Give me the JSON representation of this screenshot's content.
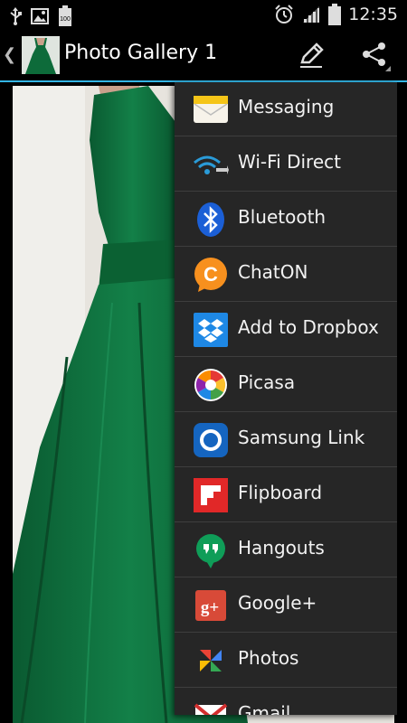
{
  "status_bar": {
    "time": "12:35",
    "battery_level": "100"
  },
  "action_bar": {
    "title": "Photo Gallery 1"
  },
  "share_menu": {
    "items": [
      {
        "label": "Messaging",
        "icon": "messaging-icon"
      },
      {
        "label": "Wi-Fi Direct",
        "icon": "wifi-direct-icon"
      },
      {
        "label": "Bluetooth",
        "icon": "bluetooth-icon"
      },
      {
        "label": "ChatON",
        "icon": "chaton-icon"
      },
      {
        "label": "Add to Dropbox",
        "icon": "dropbox-icon"
      },
      {
        "label": "Picasa",
        "icon": "picasa-icon"
      },
      {
        "label": "Samsung Link",
        "icon": "samsung-link-icon"
      },
      {
        "label": "Flipboard",
        "icon": "flipboard-icon"
      },
      {
        "label": "Hangouts",
        "icon": "hangouts-icon"
      },
      {
        "label": "Google+",
        "icon": "google-plus-icon"
      },
      {
        "label": "Photos",
        "icon": "photos-icon"
      },
      {
        "label": "Gmail",
        "icon": "gmail-icon"
      }
    ]
  },
  "colors": {
    "accent": "#33b5e5",
    "menu_background": "#262626",
    "dress_green": "#0d6b3a"
  }
}
